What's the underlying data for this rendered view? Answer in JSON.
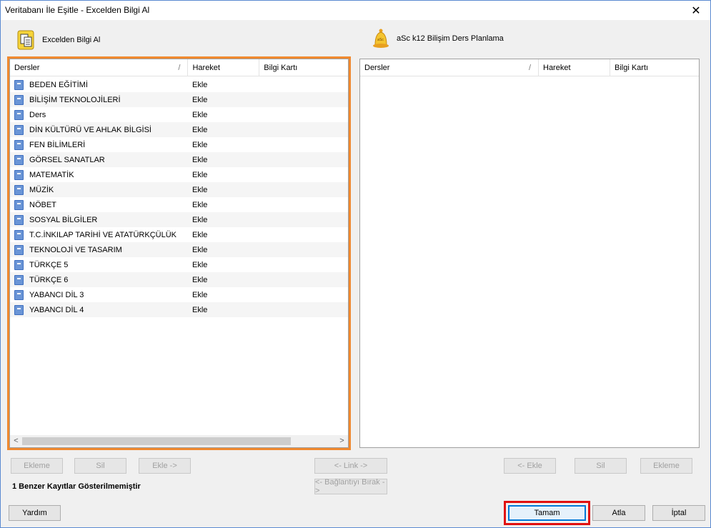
{
  "window": {
    "title": "Veritabanı İle Eşitle - Excelden Bilgi Al",
    "close_glyph": "✕"
  },
  "left_panel": {
    "header_label": "Excelden Bilgi Al",
    "header_icon": "excel-document-icon",
    "columns": [
      "Dersler",
      "Hareket",
      "Bilgi Kartı"
    ],
    "column_sort_glyph": "/",
    "rows": [
      {
        "name": "BEDEN EĞİTİMİ",
        "action": "Ekle"
      },
      {
        "name": "BİLİŞİM TEKNOLOJİLERİ",
        "action": "Ekle"
      },
      {
        "name": "Ders",
        "action": "Ekle"
      },
      {
        "name": "DİN KÜLTÜRÜ VE AHLAK BİLGİSİ",
        "action": "Ekle"
      },
      {
        "name": "FEN BİLİMLERİ",
        "action": "Ekle"
      },
      {
        "name": "GÖRSEL SANATLAR",
        "action": "Ekle"
      },
      {
        "name": "MATEMATİK",
        "action": "Ekle"
      },
      {
        "name": "MÜZİK",
        "action": "Ekle"
      },
      {
        "name": "NÖBET",
        "action": "Ekle"
      },
      {
        "name": "SOSYAL BİLGİLER",
        "action": "Ekle"
      },
      {
        "name": "T.C.İNKILAP TARİHİ VE ATATÜRKÇÜLÜK",
        "action": "Ekle"
      },
      {
        "name": "TEKNOLOJİ VE TASARIM",
        "action": "Ekle"
      },
      {
        "name": "TÜRKÇE 5",
        "action": "Ekle"
      },
      {
        "name": "TÜRKÇE 6",
        "action": "Ekle"
      },
      {
        "name": "YABANCI DİL 3",
        "action": "Ekle"
      },
      {
        "name": "YABANCI DİL 4",
        "action": "Ekle"
      }
    ],
    "scroll_left": "<",
    "scroll_right": ">"
  },
  "right_panel": {
    "header_label": "aSc k12 Bilişim Ders Planlama",
    "header_icon": "asc-bell-icon",
    "columns": [
      "Dersler",
      "Hareket",
      "Bilgi Kartı"
    ],
    "column_sort_glyph": "/"
  },
  "buttons": {
    "left_ekleme": "Ekleme",
    "left_sil": "Sil",
    "left_ekle": "Ekle ->",
    "link": "<- Link ->",
    "unlink": "<- Bağlantıyı Bırak ->",
    "right_ekle": "<- Ekle",
    "right_sil": "Sil",
    "right_ekleme": "Ekleme",
    "help": "Yardım",
    "ok": "Tamam",
    "skip": "Atla",
    "cancel": "İptal"
  },
  "status": "1 Benzer Kayıtlar Gösterilmemiştir",
  "colors": {
    "highlight_orange": "#f0892f",
    "highlight_red": "#e01010",
    "ok_button_border": "#0078d7"
  }
}
